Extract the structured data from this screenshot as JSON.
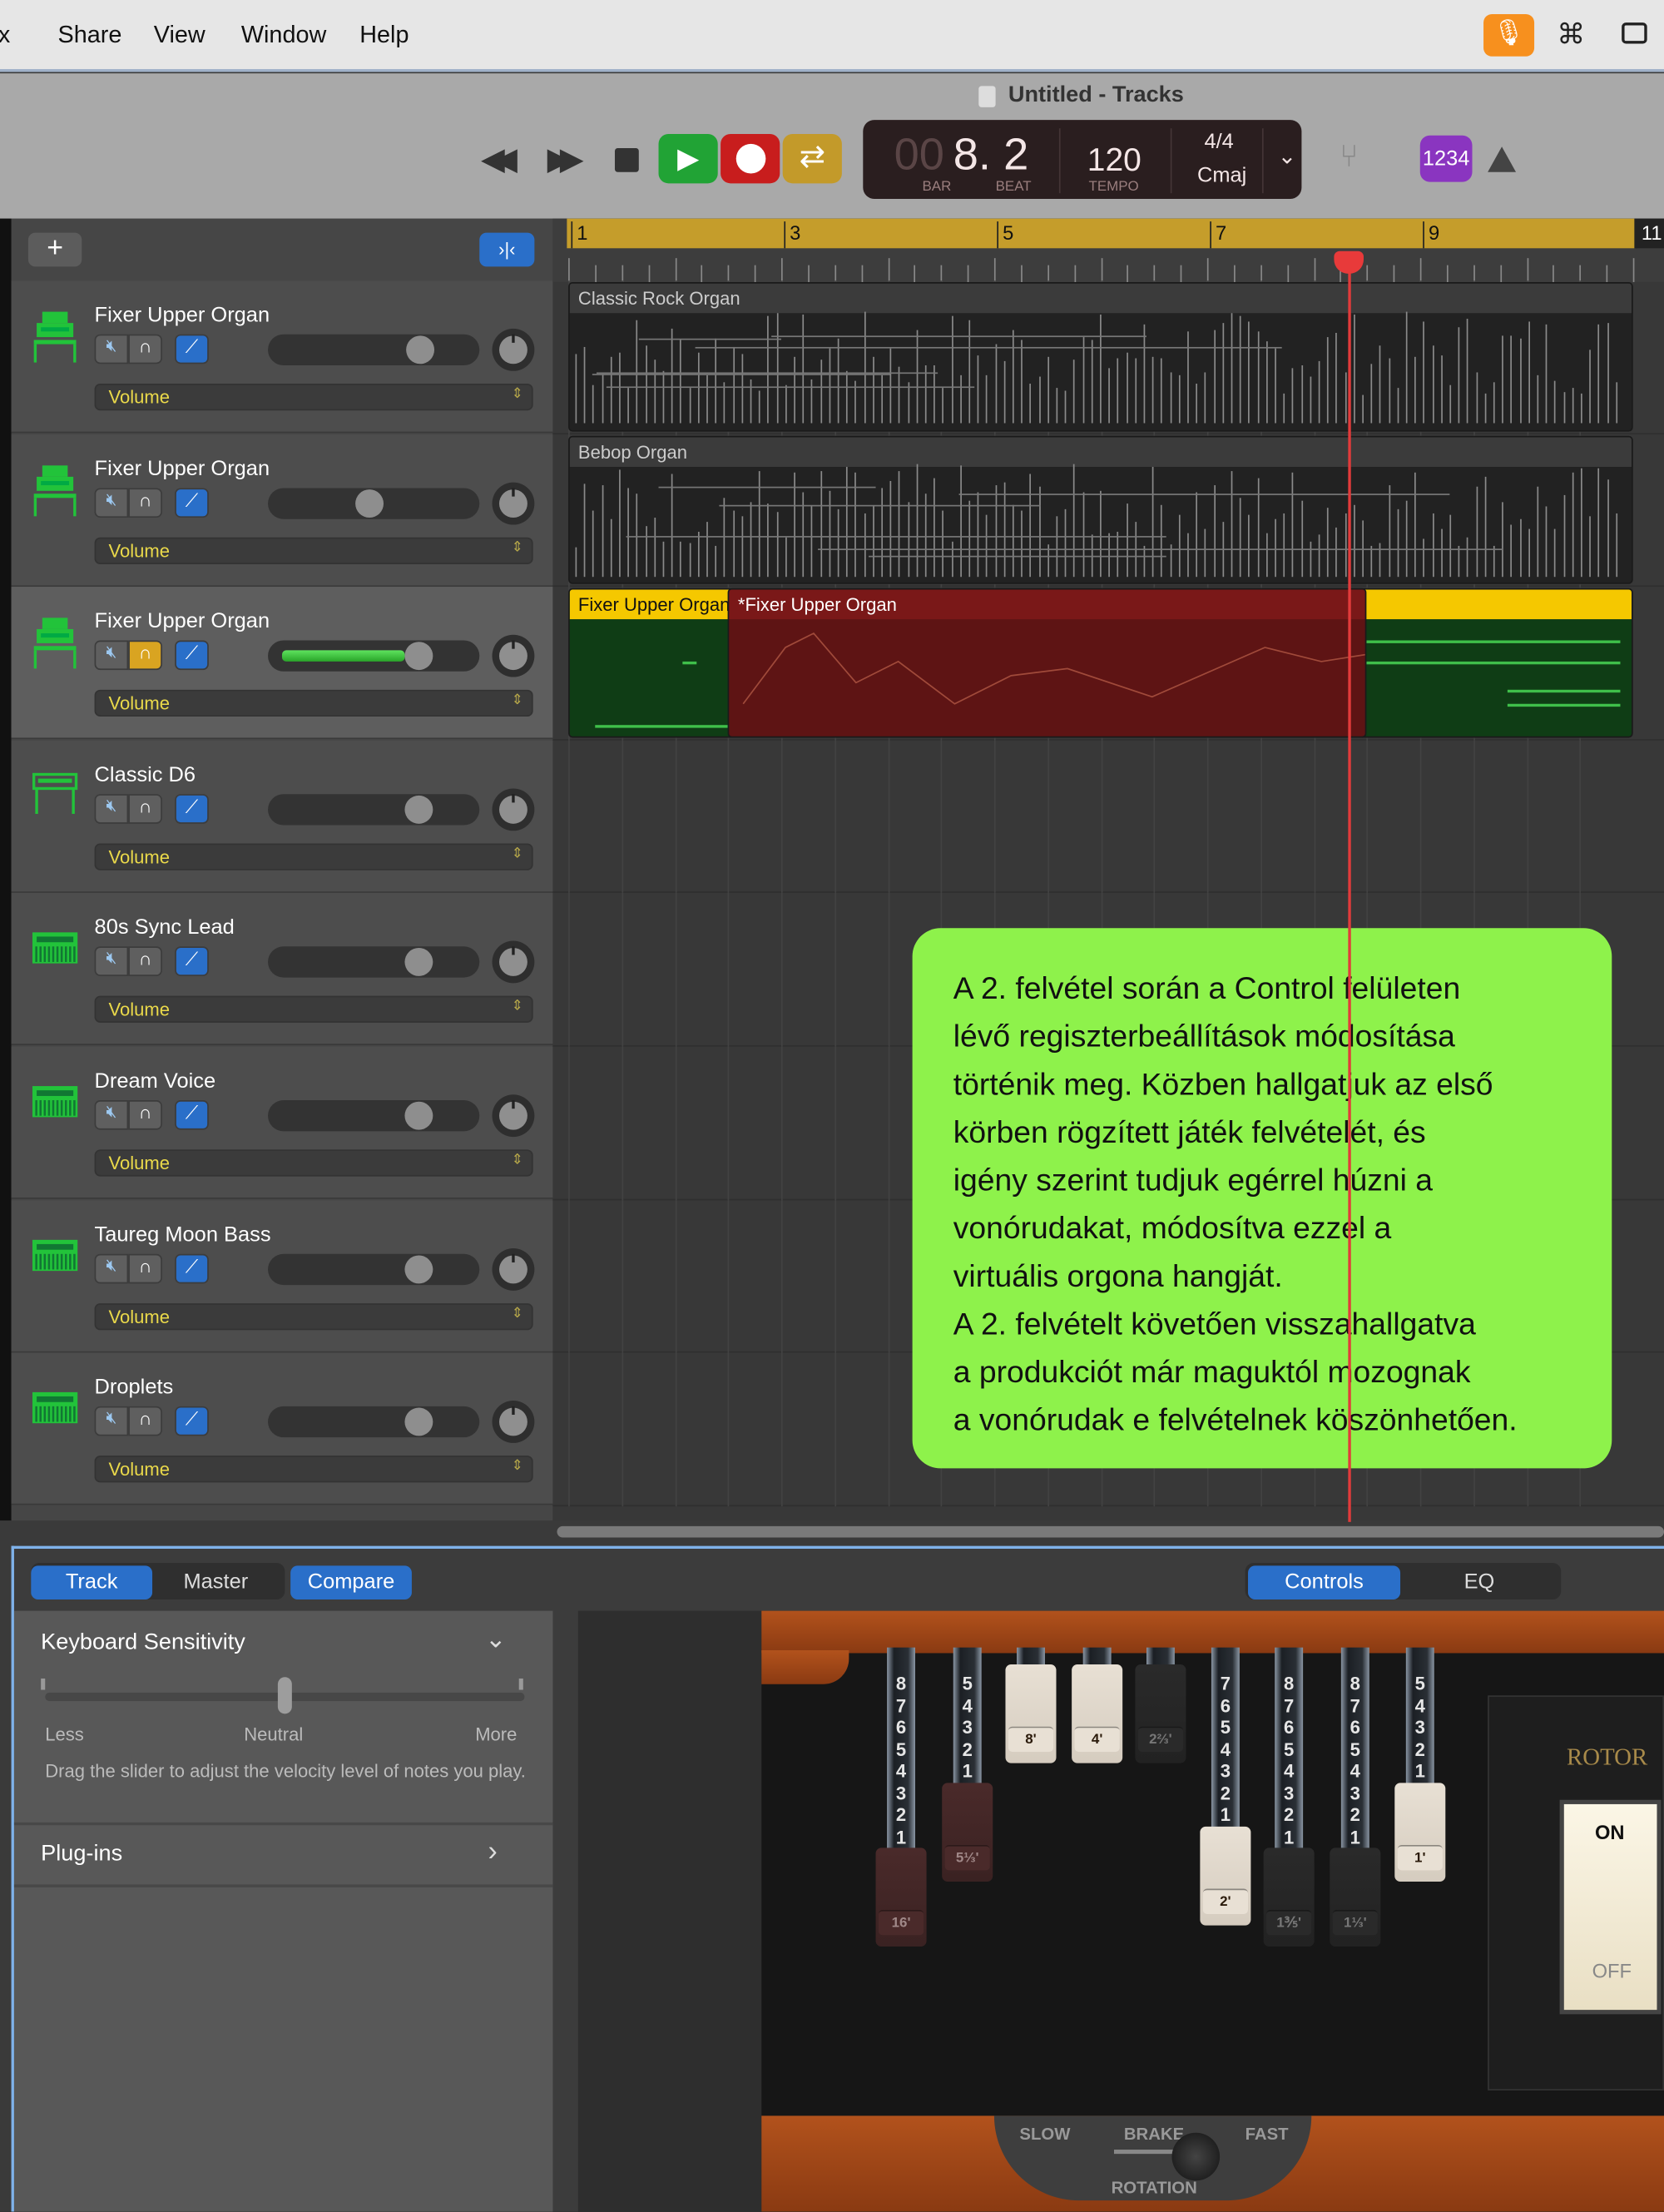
{
  "menubar": {
    "items": [
      "ix",
      "Share",
      "View",
      "Window",
      "Help"
    ],
    "mic_color": "#f7901e"
  },
  "window": {
    "title": "Untitled - Tracks"
  },
  "transport": {
    "play_color": "#21a335",
    "record_color": "#c81d1d",
    "cycle_color": "#c39a2a"
  },
  "lcd": {
    "bar_dim": "00",
    "position": "8. 2",
    "bar_label": "BAR",
    "beat_label": "BEAT",
    "tempo": "120",
    "tempo_label": "TEMPO",
    "signature": "4/4",
    "key": "Cmaj"
  },
  "count_in": {
    "label": "1234",
    "color": "#8a35c0"
  },
  "ruler": {
    "bars": [
      "1",
      "3",
      "5",
      "7",
      "9",
      "11"
    ],
    "playhead_bar": 8.2
  },
  "tracks": [
    {
      "name": "Fixer Upper Organ",
      "icon": "organ-icon",
      "volume": 0.72,
      "control": "Volume"
    },
    {
      "name": "Fixer Upper Organ",
      "icon": "organ-icon",
      "volume": 0.48,
      "control": "Volume"
    },
    {
      "name": "Fixer Upper Organ",
      "icon": "organ-icon",
      "volume": 0.71,
      "control": "Volume",
      "selected": true,
      "solo": true
    },
    {
      "name": "Classic D6",
      "icon": "clavinet-icon",
      "volume": 0.71,
      "control": "Volume"
    },
    {
      "name": "80s Sync Lead",
      "icon": "synth-icon",
      "volume": 0.71,
      "control": "Volume"
    },
    {
      "name": "Dream Voice",
      "icon": "synth-icon",
      "volume": 0.71,
      "control": "Volume"
    },
    {
      "name": "Taureg Moon Bass",
      "icon": "synth-icon",
      "volume": 0.71,
      "control": "Volume"
    },
    {
      "name": "Droplets",
      "icon": "synth-icon",
      "volume": 0.71,
      "control": "Volume"
    }
  ],
  "regions": [
    {
      "track": 0,
      "name": "Classic Rock Organ",
      "start": 1,
      "end": 11,
      "kind": "midi-gray"
    },
    {
      "track": 1,
      "name": "Bebop Organ",
      "start": 1,
      "end": 11,
      "kind": "midi-gray"
    },
    {
      "track": 2,
      "name": "Fixer Upper Organ",
      "start": 1,
      "end": 11,
      "kind": "midi-green"
    },
    {
      "track": 2,
      "name": "*Fixer Upper Organ",
      "start": 2.5,
      "end": 8.5,
      "kind": "automation-red"
    }
  ],
  "callout": {
    "lines": [
      "A 2. felvétel során a Control felületen",
      "lévő regiszterbeállítások módosítása",
      "történik meg. Közben hallgatjuk az első",
      "körben rögzített játék felvételét, és",
      "igény szerint tudjuk egérrel húzni a",
      "vonórudakat, módosítva ezzel a",
      "virtuális orgona hangját.",
      "A 2. felvételt követően visszahallgatva",
      "a produkciót már maguktól mozognak",
      "a vonórudak e felvételnek köszönhetően."
    ]
  },
  "bottom": {
    "tabs": [
      "Track",
      "Master"
    ],
    "compare": "Compare",
    "view_tabs": [
      "Controls",
      "EQ"
    ],
    "keyboard_sensitivity": {
      "title": "Keyboard Sensitivity",
      "less": "Less",
      "neutral": "Neutral",
      "more": "More",
      "value": 0.5,
      "help": "Drag the slider to adjust the velocity level of notes you play."
    },
    "plugins": "Plug-ins"
  },
  "organ": {
    "drawbars": [
      {
        "label": "16'",
        "value": 8,
        "color": "brown"
      },
      {
        "label": "5⅓'",
        "value": 5,
        "color": "brown"
      },
      {
        "label": "8'",
        "value": 0,
        "color": "white"
      },
      {
        "label": "4'",
        "value": 0,
        "color": "white"
      },
      {
        "label": "2⅔'",
        "value": 0,
        "color": "black"
      },
      {
        "label": "2'",
        "value": 7,
        "color": "white"
      },
      {
        "label": "1⅗'",
        "value": 8,
        "color": "black"
      },
      {
        "label": "1⅓'",
        "value": 8,
        "color": "black"
      },
      {
        "label": "1'",
        "value": 5,
        "color": "white"
      }
    ],
    "rotor": {
      "title": "ROTOR",
      "on": "ON",
      "off": "OFF",
      "state": "on"
    },
    "rotation": {
      "slow": "SLOW",
      "brake": "BRAKE",
      "fast": "FAST",
      "label": "ROTATION",
      "value": "brake"
    }
  }
}
